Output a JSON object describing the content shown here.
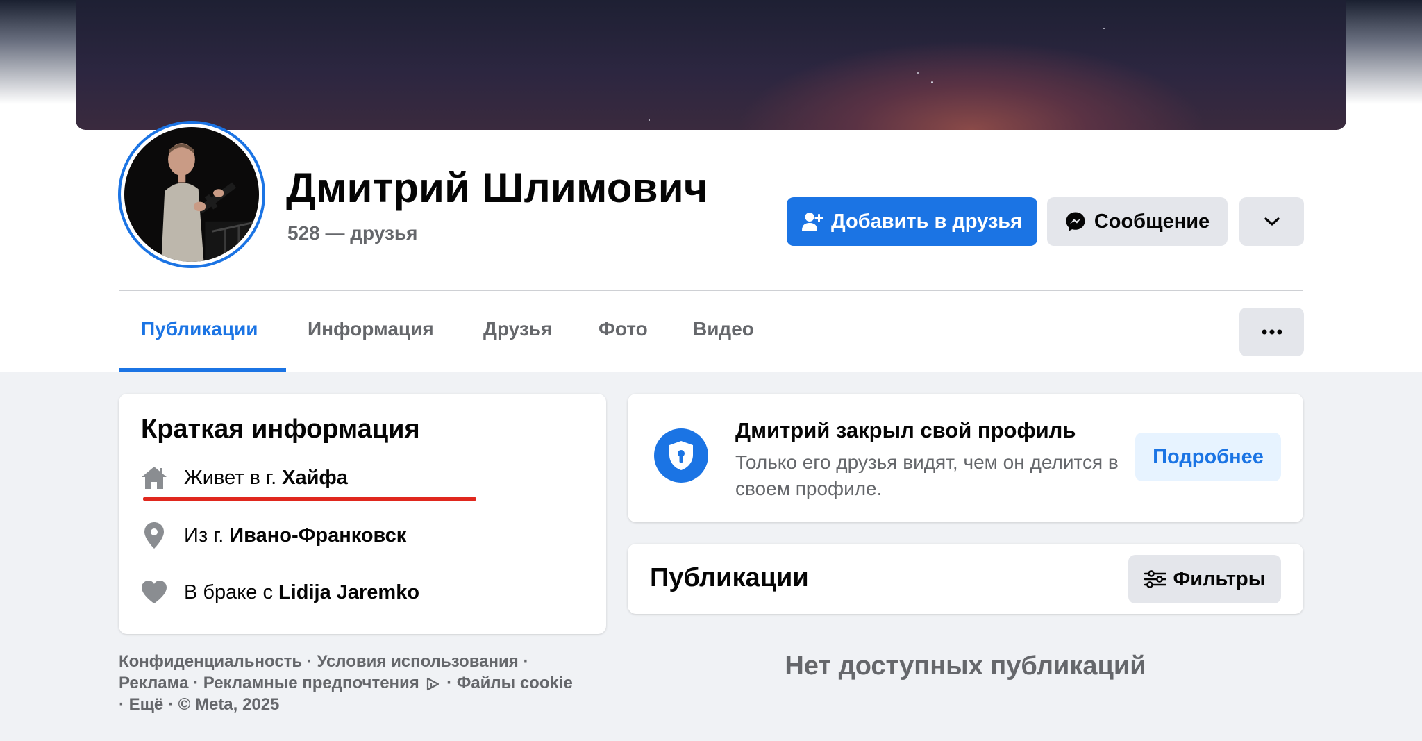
{
  "profile": {
    "name": "Дмитрий Шлимович",
    "friends_count": "528 — друзья"
  },
  "actions": {
    "add_friend": "Добавить в друзья",
    "message": "Сообщение"
  },
  "tabs": [
    {
      "label": "Публикации",
      "active": true
    },
    {
      "label": "Информация",
      "active": false
    },
    {
      "label": "Друзья",
      "active": false
    },
    {
      "label": "Фото",
      "active": false
    },
    {
      "label": "Видео",
      "active": false
    }
  ],
  "intro": {
    "title": "Краткая информация",
    "items": [
      {
        "icon": "home-icon",
        "prefix": "Живет в г.",
        "value": "Хайфа"
      },
      {
        "icon": "location-pin-icon",
        "prefix": "Из г.",
        "value": "Ивано-Франковск"
      },
      {
        "icon": "heart-icon",
        "prefix": "В браке с",
        "value": "Lidija Jaremko"
      }
    ]
  },
  "locked": {
    "title": "Дмитрий закрыл свой профиль",
    "text": "Только его друзья видят, чем он делится в своем профиле.",
    "details_label": "Подробнее"
  },
  "posts": {
    "title": "Публикации",
    "filters_label": "Фильтры",
    "empty_text": "Нет доступных публикаций"
  },
  "footer": {
    "links": [
      "Конфиденциальность",
      "Условия использования",
      "Реклама",
      "Рекламные предпочтения",
      "Файлы cookie",
      "Ещё"
    ],
    "copyright": "© Meta, 2025",
    "separator": "·"
  },
  "colors": {
    "accent": "#1b74e4",
    "highlight_underline": "#e0281e",
    "background": "#f0f2f5",
    "secondary_text": "#65676b"
  }
}
